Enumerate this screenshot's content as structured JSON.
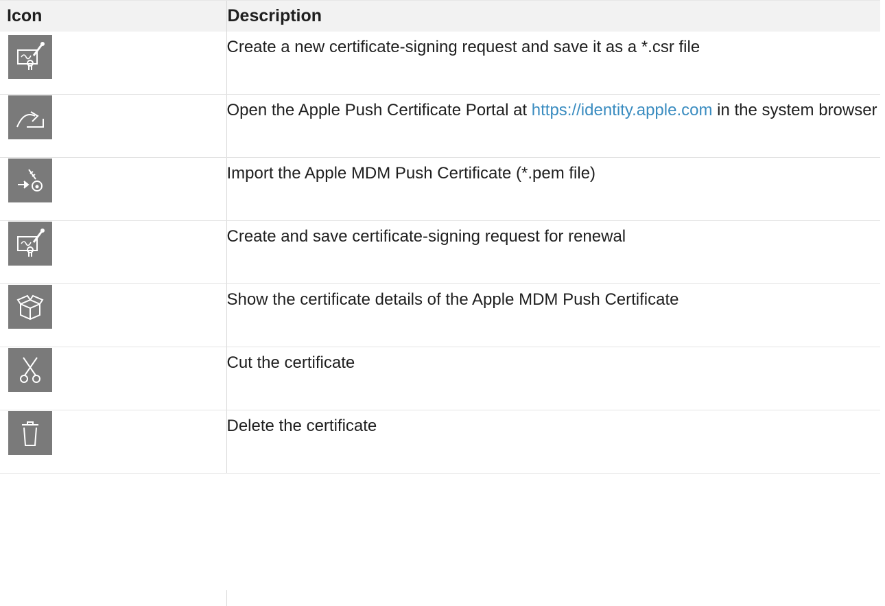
{
  "table": {
    "headers": {
      "icon": "Icon",
      "description": "Description"
    },
    "rows": [
      {
        "icon": "certificate-request-icon",
        "text": "Create a new certificate-signing request and save it as a *.csr file"
      },
      {
        "icon": "open-portal-icon",
        "text_before": "Open the Apple Push Certificate Portal at ",
        "link": "https://identity.apple.com",
        "text_after": " in the system browser"
      },
      {
        "icon": "import-key-icon",
        "text": "Import the Apple MDM Push Certificate (*.pem file)"
      },
      {
        "icon": "certificate-request-icon",
        "text": "Create and save certificate-signing request for renewal"
      },
      {
        "icon": "box-details-icon",
        "text": "Show the certificate details of the Apple MDM Push Certificate"
      },
      {
        "icon": "scissors-icon",
        "text": "Cut the certificate"
      },
      {
        "icon": "trash-icon",
        "text": "Delete the certificate"
      }
    ]
  },
  "colors": {
    "icon_bg": "#7a7a7a",
    "header_bg": "#f2f2f2",
    "link": "#3a8cc0"
  }
}
